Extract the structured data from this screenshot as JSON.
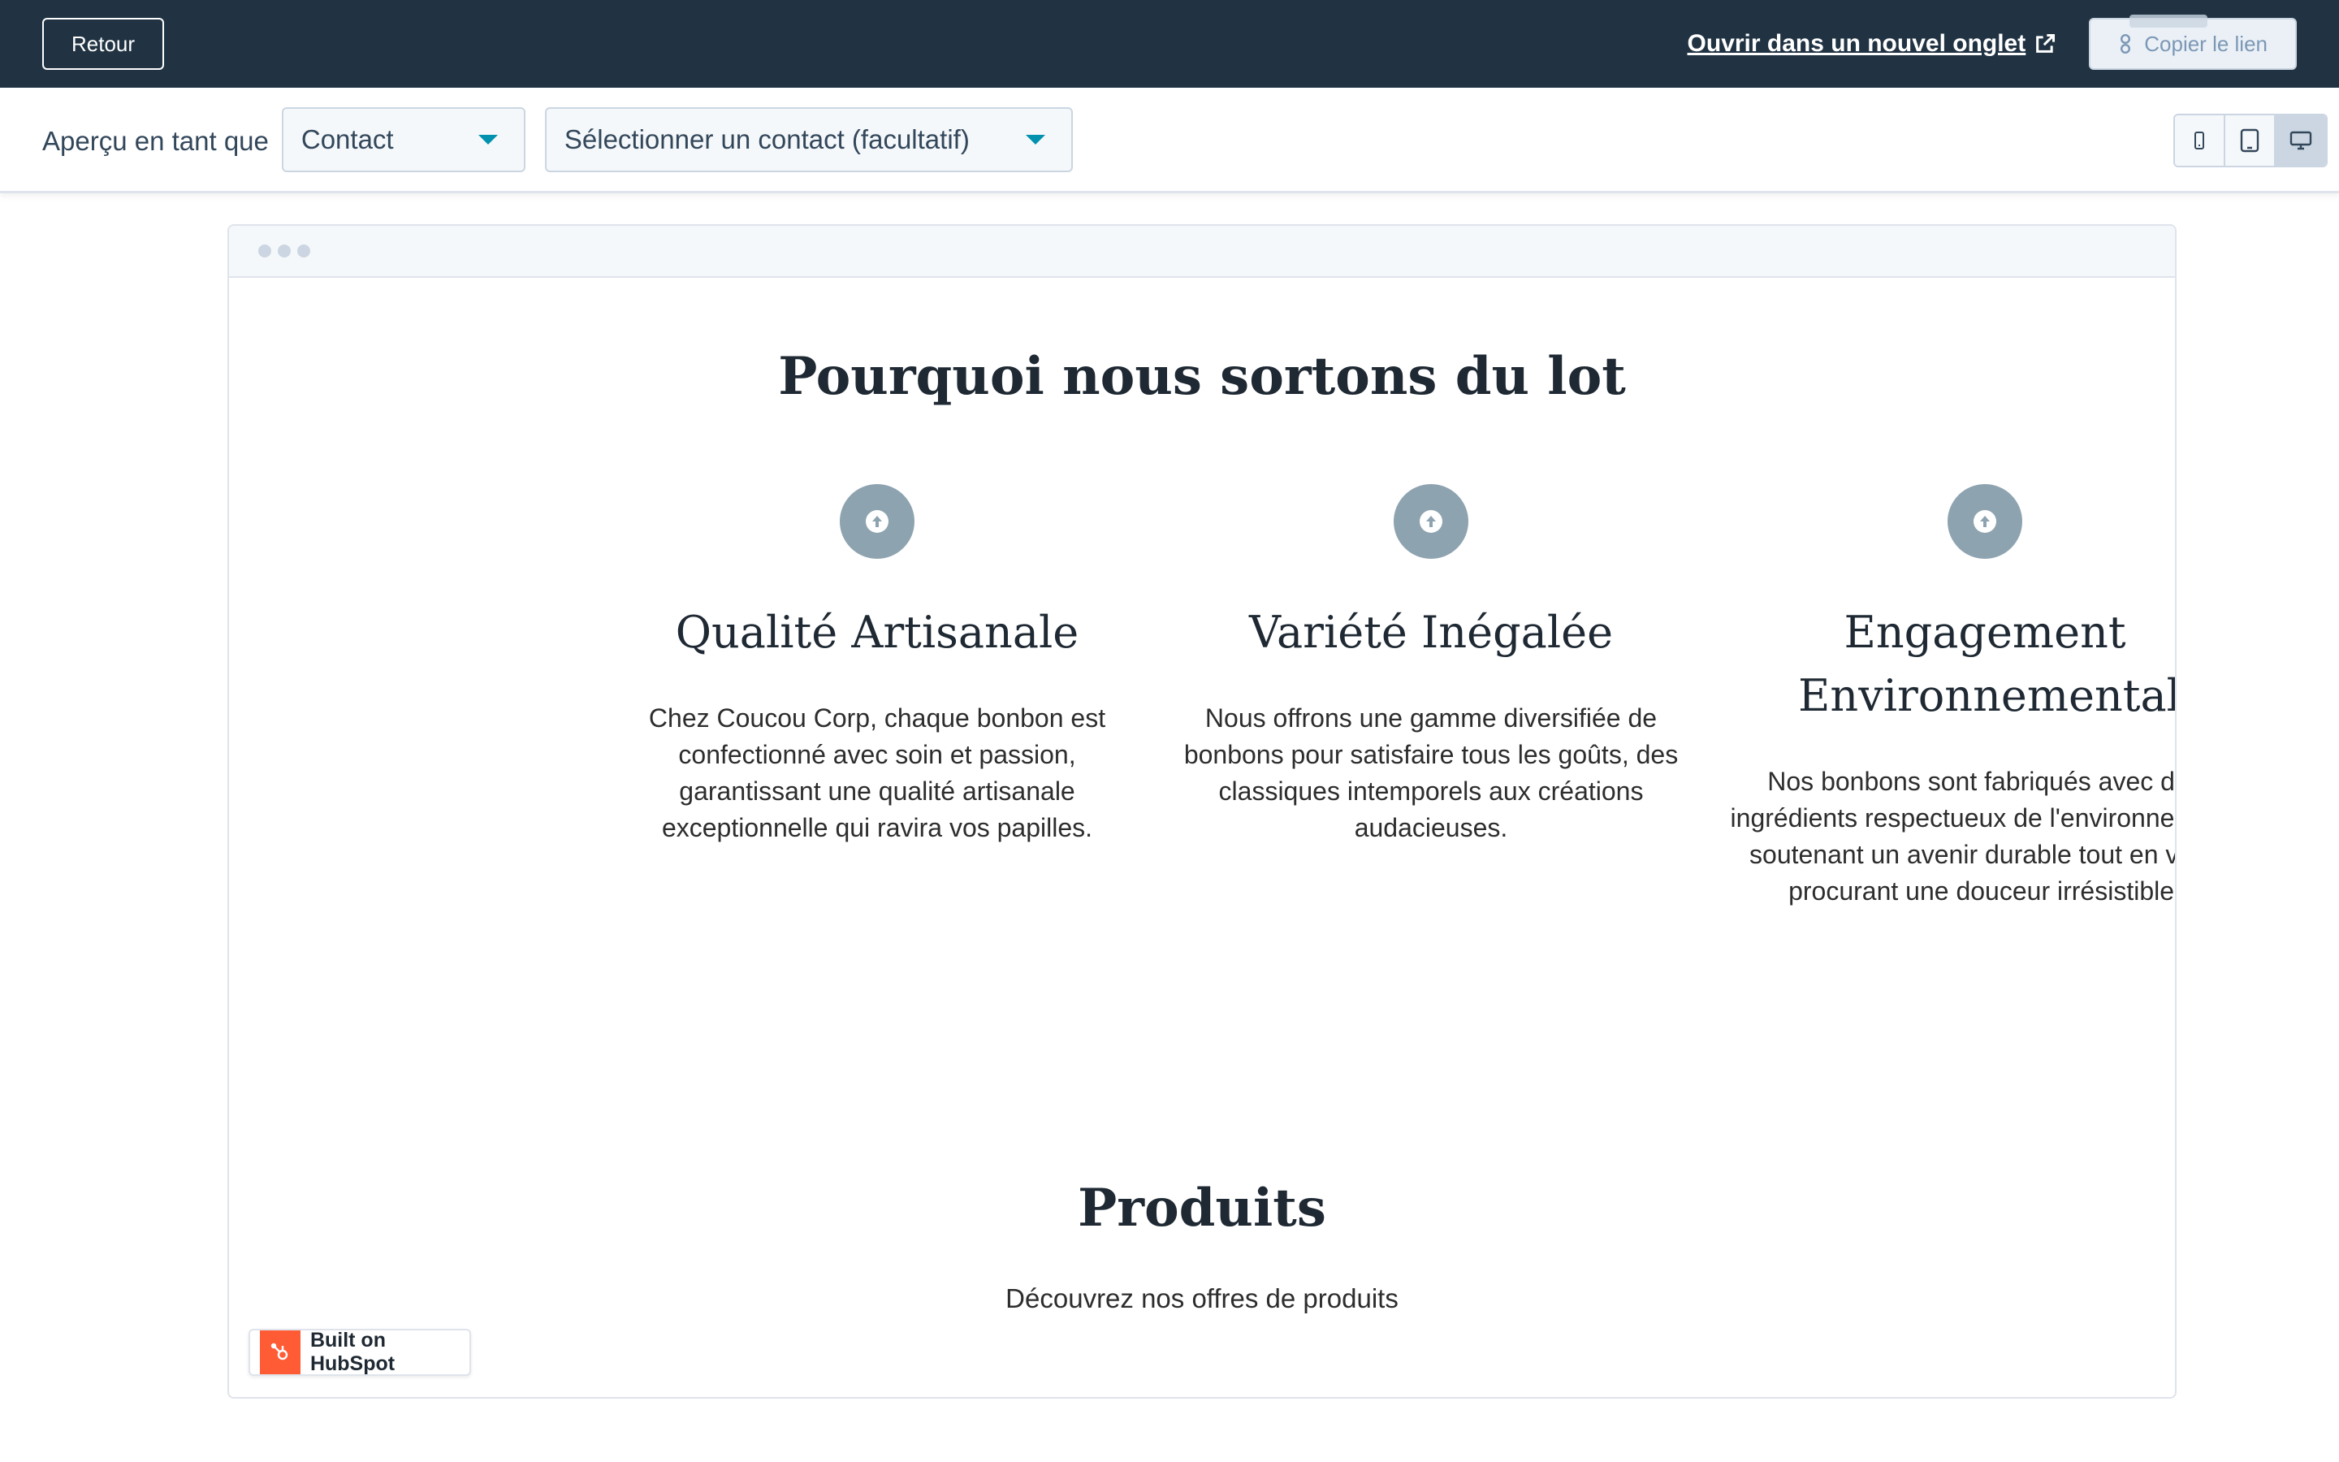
{
  "topbar": {
    "back_label": "Retour",
    "open_new_tab_label": "Ouvrir dans un nouvel onglet",
    "copy_link_label": "Copier le lien"
  },
  "toolbar": {
    "preview_as_label": "Aperçu en tant que",
    "preview_type_value": "Contact",
    "contact_select_value": "Sélectionner un contact (facultatif)",
    "devices": [
      "mobile-icon",
      "tablet-icon",
      "desktop-icon"
    ],
    "active_device": "desktop"
  },
  "page": {
    "why_title": "Pourquoi nous sortons du lot",
    "features": [
      {
        "title": "Qualité Artisanale",
        "text": "Chez Coucou Corp, chaque bonbon est confectionné avec soin et passion, garantissant une qualité artisanale exceptionnelle qui ravira vos papilles."
      },
      {
        "title": "Variété Inégalée",
        "text": "Nous offrons une gamme diversifiée de bonbons pour satisfaire tous les goûts, des classiques intemporels aux créations audacieuses."
      },
      {
        "title": "Engagement Environnemental",
        "text": "Nos bonbons sont fabriqués avec des ingrédients respectueux de l'environnement, soutenant un avenir durable tout en vous procurant une douceur irrésistible."
      }
    ],
    "products_title": "Produits",
    "products_subtitle": "Découvrez nos offres de produits"
  },
  "badge": {
    "label": "Built on HubSpot"
  },
  "colors": {
    "topbar_bg": "#213343",
    "accent": "#0091ae",
    "icon_circle": "#8ea3b0",
    "hubspot_orange": "#ff5c35"
  }
}
